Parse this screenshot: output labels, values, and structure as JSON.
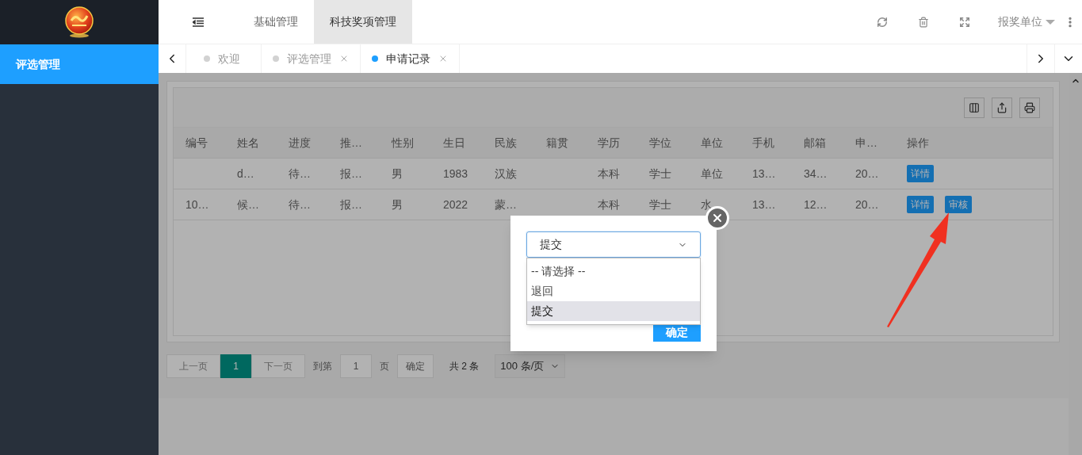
{
  "sidebar": {
    "items": [
      {
        "label": "评选管理",
        "selected": true
      }
    ]
  },
  "top_nav": {
    "items": [
      {
        "label": "基础管理",
        "selected": false
      },
      {
        "label": "科技奖项管理",
        "selected": true
      }
    ],
    "user": "报奖单位"
  },
  "tabs": [
    {
      "label": "欢迎",
      "selected": false,
      "closable": false
    },
    {
      "label": "评选管理",
      "selected": false,
      "closable": true
    },
    {
      "label": "申请记录",
      "selected": true,
      "closable": true
    }
  ],
  "table": {
    "columns": [
      "编号",
      "姓名",
      "进度",
      "推…",
      "性别",
      "生日",
      "民族",
      "籍贯",
      "学历",
      "学位",
      "单位",
      "手机",
      "邮箱",
      "申…",
      "操作"
    ],
    "rows": [
      {
        "cells": [
          "",
          "d…",
          "待…",
          "报…",
          "男",
          "1983",
          "汉族",
          "",
          "本科",
          "学士",
          "单位",
          "13…",
          "34…",
          "20…"
        ],
        "actions": [
          "详情"
        ]
      },
      {
        "cells": [
          "10…",
          "候…",
          "待…",
          "报…",
          "男",
          "2022",
          "蒙…",
          "",
          "本科",
          "学士",
          "水",
          "13…",
          "12…",
          "20…"
        ],
        "actions": [
          "详情",
          "审核"
        ]
      }
    ]
  },
  "pagination": {
    "prev": "上一页",
    "pages": [
      {
        "label": "1",
        "selected": true
      }
    ],
    "next": "下一页",
    "goto_label": "到第",
    "goto_value": "1",
    "page_unit": "页",
    "goto_button": "确定",
    "total": "共 2 条",
    "page_size": "100 条/页"
  },
  "modal": {
    "select_value": "提交",
    "options": [
      {
        "label": "-- 请选择 --",
        "selected": false
      },
      {
        "label": "退回",
        "selected": false
      },
      {
        "label": "提交",
        "selected": true
      }
    ],
    "confirm": "确定"
  }
}
